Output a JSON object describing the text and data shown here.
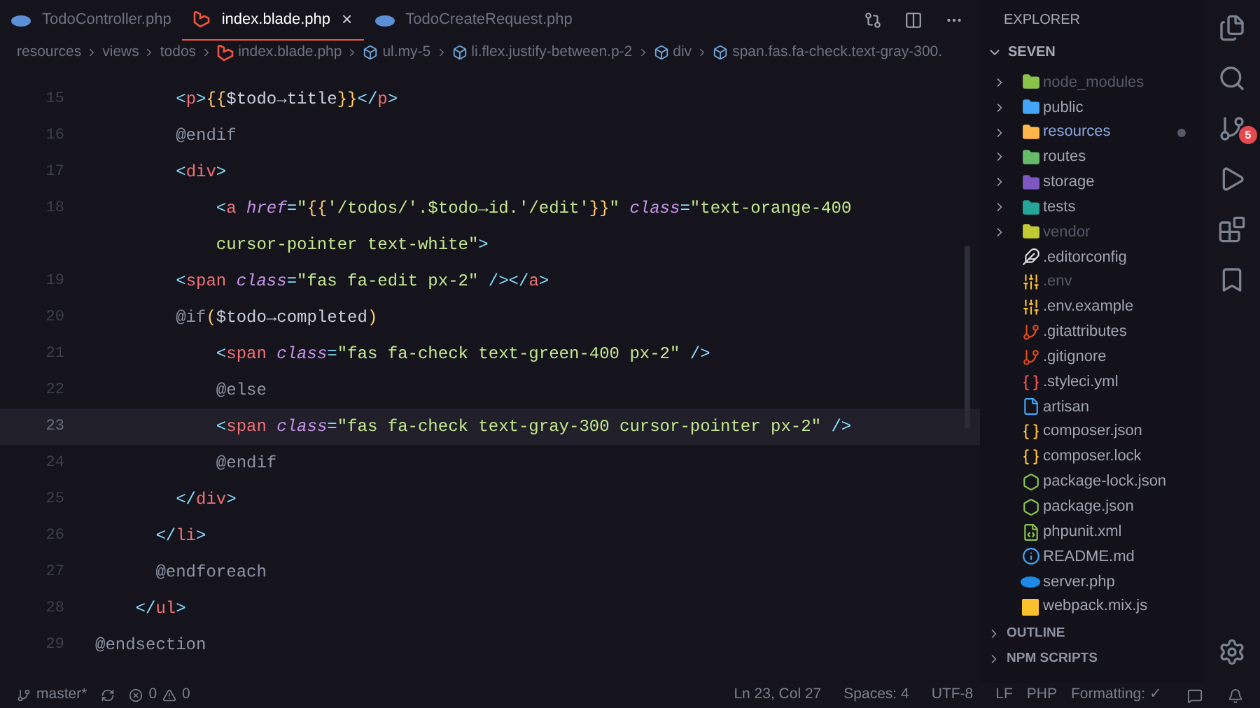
{
  "tabs": [
    {
      "label": "TodoController.php",
      "kind": "php",
      "selected": false
    },
    {
      "label": "index.blade.php",
      "kind": "blade",
      "selected": true,
      "close": "×"
    },
    {
      "label": "TodoCreateRequest.php",
      "kind": "php",
      "selected": false
    }
  ],
  "breadcrumb": [
    {
      "label": "resources",
      "kind": "folder"
    },
    {
      "label": "views",
      "kind": "folder"
    },
    {
      "label": "todos",
      "kind": "folder"
    },
    {
      "label": "index.blade.php",
      "kind": "blade"
    },
    {
      "label": "ul.my-5",
      "kind": "element"
    },
    {
      "label": "li.flex.justify-between.p-2",
      "kind": "element"
    },
    {
      "label": "div",
      "kind": "element"
    },
    {
      "label": "span.fas.fa-check.text-gray-300.",
      "kind": "element"
    }
  ],
  "code_lines": [
    {
      "number": "15",
      "current": false,
      "tokens": [
        {
          "t": "        <",
          "kind": "punct"
        },
        {
          "t": "p",
          "kind": "tag"
        },
        {
          "t": ">",
          "kind": "punct"
        },
        {
          "t": "{{",
          "kind": "brace"
        },
        {
          "t": "$todo→title",
          "kind": "var"
        },
        {
          "t": "}}",
          "kind": "brace"
        },
        {
          "t": "</",
          "kind": "punct"
        },
        {
          "t": "p",
          "kind": "tag"
        },
        {
          "t": ">",
          "kind": "punct"
        }
      ]
    },
    {
      "number": "16",
      "current": false,
      "tokens": [
        {
          "t": "        @endif",
          "kind": "directive"
        }
      ]
    },
    {
      "number": "17",
      "current": false,
      "tokens": [
        {
          "t": "        <",
          "kind": "punct"
        },
        {
          "t": "div",
          "kind": "tag"
        },
        {
          "t": ">",
          "kind": "punct"
        }
      ]
    },
    {
      "number": "18",
      "current": false,
      "tokens": [
        {
          "t": "            <",
          "kind": "punct"
        },
        {
          "t": "a",
          "kind": "tag"
        },
        {
          "t": " href",
          "kind": "attr"
        },
        {
          "t": "=",
          "kind": "punct"
        },
        {
          "t": "\"",
          "kind": "string"
        },
        {
          "t": "{{",
          "kind": "brace"
        },
        {
          "t": "'/todos/'.$todo→id.'/edit'",
          "kind": "string"
        },
        {
          "t": "}}",
          "kind": "brace"
        },
        {
          "t": "\"",
          "kind": "string"
        },
        {
          "t": " class",
          "kind": "attr"
        },
        {
          "t": "=",
          "kind": "punct"
        },
        {
          "t": "\"text-orange-400",
          "kind": "string"
        }
      ]
    },
    {
      "current": false,
      "tokens": [
        {
          "t": "            cursor-pointer text-white\"",
          "kind": "string"
        },
        {
          "t": ">",
          "kind": "punct"
        }
      ]
    },
    {
      "number": "19",
      "current": false,
      "tokens": [
        {
          "t": "        <",
          "kind": "punct"
        },
        {
          "t": "span",
          "kind": "tag"
        },
        {
          "t": " class",
          "kind": "attr"
        },
        {
          "t": "=",
          "kind": "punct"
        },
        {
          "t": "\"fas fa-edit px-2\"",
          "kind": "string"
        },
        {
          "t": " />",
          "kind": "punct"
        },
        {
          "t": "</",
          "kind": "punct"
        },
        {
          "t": "a",
          "kind": "tag"
        },
        {
          "t": ">",
          "kind": "punct"
        }
      ]
    },
    {
      "number": "20",
      "current": false,
      "tokens": [
        {
          "t": "        @if",
          "kind": "directive"
        },
        {
          "t": "(",
          "kind": "brace"
        },
        {
          "t": "$todo→completed",
          "kind": "var"
        },
        {
          "t": ")",
          "kind": "brace"
        }
      ]
    },
    {
      "number": "21",
      "current": false,
      "tokens": [
        {
          "t": "            <",
          "kind": "punct"
        },
        {
          "t": "span",
          "kind": "tag"
        },
        {
          "t": " class",
          "kind": "attr"
        },
        {
          "t": "=",
          "kind": "punct"
        },
        {
          "t": "\"fas fa-check text-green-400 px-2\"",
          "kind": "string"
        },
        {
          "t": " />",
          "kind": "punct"
        }
      ]
    },
    {
      "number": "22",
      "current": false,
      "tokens": [
        {
          "t": "            @else",
          "kind": "directive"
        }
      ]
    },
    {
      "number": "23",
      "current": true,
      "tokens": [
        {
          "t": "            <",
          "kind": "punct"
        },
        {
          "t": "span",
          "kind": "tag"
        },
        {
          "t": " class",
          "kind": "attr"
        },
        {
          "t": "=",
          "kind": "punct"
        },
        {
          "t": "\"fas fa-check text-gray-300 cursor-pointer px-2\"",
          "kind": "string"
        },
        {
          "t": " />",
          "kind": "punct"
        }
      ]
    },
    {
      "number": "24",
      "current": false,
      "tokens": [
        {
          "t": "            @endif",
          "kind": "directive"
        }
      ]
    },
    {
      "number": "25",
      "current": false,
      "tokens": [
        {
          "t": "        </",
          "kind": "punct"
        },
        {
          "t": "div",
          "kind": "tag"
        },
        {
          "t": ">",
          "kind": "punct"
        }
      ]
    },
    {
      "number": "26",
      "current": false,
      "tokens": [
        {
          "t": "      </",
          "kind": "punct"
        },
        {
          "t": "li",
          "kind": "tag"
        },
        {
          "t": ">",
          "kind": "punct"
        }
      ]
    },
    {
      "number": "27",
      "current": false,
      "tokens": [
        {
          "t": "      @endforeach",
          "kind": "directive"
        }
      ]
    },
    {
      "number": "28",
      "current": false,
      "tokens": [
        {
          "t": "    </",
          "kind": "punct"
        },
        {
          "t": "ul",
          "kind": "tag"
        },
        {
          "t": ">",
          "kind": "punct"
        }
      ]
    },
    {
      "number": "29",
      "current": false,
      "tokens": [
        {
          "t": "@endsection",
          "kind": "directive"
        }
      ]
    }
  ],
  "explorer": {
    "title": "EXPLORER",
    "root": "SEVEN",
    "items": [
      {
        "label": "node_modules",
        "kind": "folder",
        "color": "#8bc34a",
        "dimmed": true,
        "modified": false
      },
      {
        "label": "public",
        "kind": "folder",
        "color": "#42a5f5",
        "dimmed": false,
        "modified": false
      },
      {
        "label": "resources",
        "kind": "folder",
        "color": "#ffb74d",
        "dimmed": false,
        "modified": true
      },
      {
        "label": "routes",
        "kind": "folder",
        "color": "#66bb6a",
        "dimmed": false,
        "modified": false
      },
      {
        "label": "storage",
        "kind": "folder",
        "color": "#7e57c2",
        "dimmed": false,
        "modified": false
      },
      {
        "label": "tests",
        "kind": "folder",
        "color": "#26a69a",
        "dimmed": false,
        "modified": false
      },
      {
        "label": "vendor",
        "kind": "folder",
        "color": "#c0ca33",
        "dimmed": true,
        "modified": false
      },
      {
        "label": ".editorconfig",
        "kind": "editorconfig",
        "color": "#e0e0e0",
        "dimmed": false,
        "modified": false
      },
      {
        "label": ".env",
        "kind": "env",
        "color": "#fbc02d",
        "dimmed": true,
        "modified": false
      },
      {
        "label": ".env.example",
        "kind": "env",
        "color": "#fbc02d",
        "dimmed": false,
        "modified": false
      },
      {
        "label": ".gitattributes",
        "kind": "git",
        "color": "#e64a19",
        "dimmed": false,
        "modified": false
      },
      {
        "label": ".gitignore",
        "kind": "git",
        "color": "#e64a19",
        "dimmed": false,
        "modified": false
      },
      {
        "label": ".styleci.yml",
        "kind": "braces",
        "color": "#ef5350",
        "dimmed": false,
        "modified": false
      },
      {
        "label": "artisan",
        "kind": "file",
        "color": "#42a5f5",
        "dimmed": false,
        "modified": false
      },
      {
        "label": "composer.json",
        "kind": "braces",
        "color": "#fbc02d",
        "dimmed": false,
        "modified": false
      },
      {
        "label": "composer.lock",
        "kind": "braces",
        "color": "#fbc02d",
        "dimmed": false,
        "modified": false
      },
      {
        "label": "package-lock.json",
        "kind": "npm",
        "color": "#8bc34a",
        "dimmed": false,
        "modified": false
      },
      {
        "label": "package.json",
        "kind": "npm",
        "color": "#8bc34a",
        "dimmed": false,
        "modified": false
      },
      {
        "label": "phpunit.xml",
        "kind": "xml",
        "color": "#8bc34a",
        "dimmed": false,
        "modified": false
      },
      {
        "label": "README.md",
        "kind": "info",
        "color": "#42a5f5",
        "dimmed": false,
        "modified": false
      },
      {
        "label": "server.php",
        "kind": "php",
        "color": "#1e88e5",
        "dimmed": false,
        "modified": false
      },
      {
        "label": "webpack.mix.js",
        "kind": "js",
        "color": "#fbc02d",
        "dimmed": false,
        "modified": false
      }
    ],
    "sections": [
      "OUTLINE",
      "NPM SCRIPTS"
    ]
  },
  "activity_bar": {
    "source_control_badge": "5"
  },
  "status_bar": {
    "branch": "master*",
    "errors": "0",
    "warnings": "0",
    "position": "Ln 23, Col 27",
    "indentation": "Spaces: 4",
    "encoding": "UTF-8",
    "eol": "LF",
    "language": "PHP",
    "formatting": "Formatting: ✓"
  }
}
